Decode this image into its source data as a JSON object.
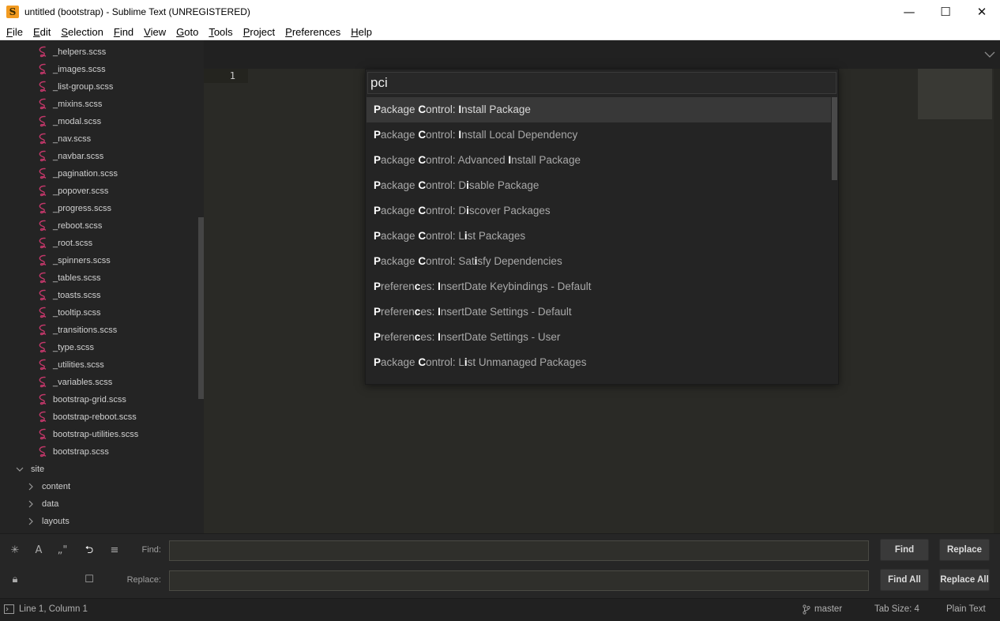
{
  "window": {
    "title": "untitled (bootstrap) - Sublime Text (UNREGISTERED)",
    "minimize": "—",
    "maximize": "☐",
    "close": "✕"
  },
  "menu": [
    "File",
    "Edit",
    "Selection",
    "Find",
    "View",
    "Goto",
    "Tools",
    "Project",
    "Preferences",
    "Help"
  ],
  "sidebar": {
    "files": [
      "_helpers.scss",
      "_images.scss",
      "_list-group.scss",
      "_mixins.scss",
      "_modal.scss",
      "_nav.scss",
      "_navbar.scss",
      "_pagination.scss",
      "_popover.scss",
      "_progress.scss",
      "_reboot.scss",
      "_root.scss",
      "_spinners.scss",
      "_tables.scss",
      "_toasts.scss",
      "_tooltip.scss",
      "_transitions.scss",
      "_type.scss",
      "_utilities.scss",
      "_variables.scss",
      "bootstrap-grid.scss",
      "bootstrap-reboot.scss",
      "bootstrap-utilities.scss",
      "bootstrap.scss"
    ],
    "site_folder": "site",
    "site_children": [
      "content",
      "data",
      "layouts"
    ]
  },
  "editor": {
    "line_number": "1"
  },
  "palette": {
    "query": "pci",
    "items": [
      [
        [
          "P",
          1
        ],
        [
          "ackage ",
          0
        ],
        [
          "C",
          1
        ],
        [
          "ontrol: ",
          0
        ],
        [
          "I",
          1
        ],
        [
          "nstall Package",
          0
        ]
      ],
      [
        [
          "P",
          1
        ],
        [
          "ackage ",
          0
        ],
        [
          "C",
          1
        ],
        [
          "ontrol: ",
          0
        ],
        [
          "I",
          1
        ],
        [
          "nstall Local Dependency",
          0
        ]
      ],
      [
        [
          "P",
          1
        ],
        [
          "ackage ",
          0
        ],
        [
          "C",
          1
        ],
        [
          "ontrol: Advanced ",
          0
        ],
        [
          "I",
          1
        ],
        [
          "nstall Package",
          0
        ]
      ],
      [
        [
          "P",
          1
        ],
        [
          "ackage ",
          0
        ],
        [
          "C",
          1
        ],
        [
          "ontrol: D",
          0
        ],
        [
          "i",
          1
        ],
        [
          "sable Package",
          0
        ]
      ],
      [
        [
          "P",
          1
        ],
        [
          "ackage ",
          0
        ],
        [
          "C",
          1
        ],
        [
          "ontrol: D",
          0
        ],
        [
          "i",
          1
        ],
        [
          "scover Packages",
          0
        ]
      ],
      [
        [
          "P",
          1
        ],
        [
          "ackage ",
          0
        ],
        [
          "C",
          1
        ],
        [
          "ontrol: L",
          0
        ],
        [
          "i",
          1
        ],
        [
          "st Packages",
          0
        ]
      ],
      [
        [
          "P",
          1
        ],
        [
          "ackage ",
          0
        ],
        [
          "C",
          1
        ],
        [
          "ontrol: Sat",
          0
        ],
        [
          "i",
          1
        ],
        [
          "sfy Dependencies",
          0
        ]
      ],
      [
        [
          "P",
          1
        ],
        [
          "referen",
          0
        ],
        [
          "c",
          1
        ],
        [
          "es: ",
          0
        ],
        [
          "I",
          1
        ],
        [
          "nsertDate Keybindings - Default",
          0
        ]
      ],
      [
        [
          "P",
          1
        ],
        [
          "referen",
          0
        ],
        [
          "c",
          1
        ],
        [
          "es: ",
          0
        ],
        [
          "I",
          1
        ],
        [
          "nsertDate Settings - Default",
          0
        ]
      ],
      [
        [
          "P",
          1
        ],
        [
          "referen",
          0
        ],
        [
          "c",
          1
        ],
        [
          "es: ",
          0
        ],
        [
          "I",
          1
        ],
        [
          "nsertDate Settings - User",
          0
        ]
      ],
      [
        [
          "P",
          1
        ],
        [
          "ackage ",
          0
        ],
        [
          "C",
          1
        ],
        [
          "ontrol: L",
          0
        ],
        [
          "i",
          1
        ],
        [
          "st Unmanaged Packages",
          0
        ]
      ]
    ]
  },
  "find_panel": {
    "find_label": "Find:",
    "replace_label": "Replace:",
    "find_value": "",
    "replace_value": "",
    "find_button": "Find",
    "replace_button": "Replace",
    "find_all_button": "Find All",
    "replace_all_button": "Replace All"
  },
  "status": {
    "position": "Line 1, Column 1",
    "branch": "master",
    "tab_size": "Tab Size: 4",
    "syntax": "Plain Text"
  },
  "colors": {
    "accent_icon": "#f29b21",
    "sass_icon": "#c4376a"
  }
}
